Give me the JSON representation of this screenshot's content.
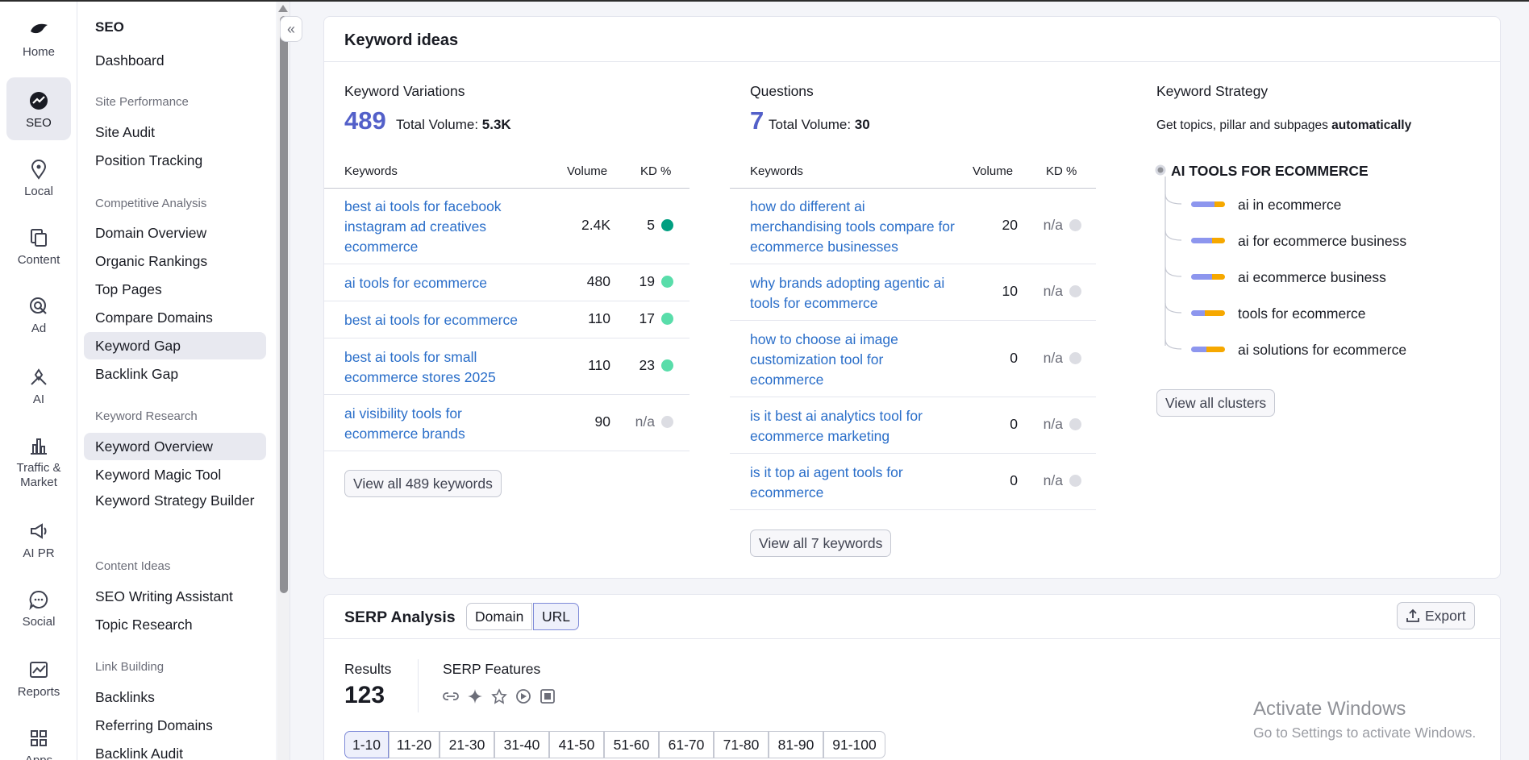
{
  "rail": [
    {
      "label": "Home",
      "icon": "home-icon"
    },
    {
      "label": "SEO",
      "icon": "seo-icon",
      "active": true
    },
    {
      "label": "Local",
      "icon": "location-pin-icon"
    },
    {
      "label": "Content",
      "icon": "content-icon"
    },
    {
      "label": "Ad",
      "icon": "ad-target-icon"
    },
    {
      "label": "AI",
      "icon": "ai-icon"
    },
    {
      "label": "Traffic &\nMarket",
      "icon": "bar-chart-icon"
    },
    {
      "label": "AI PR",
      "icon": "megaphone-icon"
    },
    {
      "label": "Social",
      "icon": "chat-bubble-icon"
    },
    {
      "label": "Reports",
      "icon": "reports-icon"
    },
    {
      "label": "Apps",
      "icon": "apps-grid-icon"
    }
  ],
  "sidebar": {
    "title": "SEO",
    "dashboard": "Dashboard",
    "groups": {
      "site_performance": "Site Performance",
      "competitive_analysis": "Competitive Analysis",
      "keyword_research": "Keyword Research",
      "content_ideas": "Content Ideas",
      "link_building": "Link Building"
    },
    "items": {
      "site_audit": "Site Audit",
      "position_tracking": "Position Tracking",
      "domain_overview": "Domain Overview",
      "organic_rankings": "Organic Rankings",
      "top_pages": "Top Pages",
      "compare_domains": "Compare Domains",
      "keyword_gap": "Keyword Gap",
      "backlink_gap": "Backlink Gap",
      "keyword_overview": "Keyword Overview",
      "keyword_magic_tool": "Keyword Magic Tool",
      "keyword_strategy_builder": "Keyword Strategy Builder",
      "seo_writing_assistant": "SEO Writing Assistant",
      "topic_research": "Topic Research",
      "backlinks": "Backlinks",
      "referring_domains": "Referring Domains",
      "backlink_audit": "Backlink Audit"
    },
    "collapse_glyph": "«"
  },
  "keyword_ideas": {
    "title": "Keyword ideas",
    "variations": {
      "title": "Keyword Variations",
      "count": "489",
      "total_label": "Total Volume:",
      "total_value": "5.3K",
      "headers": {
        "keyword": "Keywords",
        "volume": "Volume",
        "kd": "KD %"
      },
      "rows": [
        {
          "kw": "best ai tools for facebook instagram ad creatives ecommerce",
          "vol": "2.4K",
          "kd": "5",
          "color": "#009f81"
        },
        {
          "kw": "ai tools for ecommerce",
          "vol": "480",
          "kd": "19",
          "color": "#59ddaa"
        },
        {
          "kw": "best ai tools for ecommerce",
          "vol": "110",
          "kd": "17",
          "color": "#59ddaa"
        },
        {
          "kw": "best ai tools for small ecommerce stores 2025",
          "vol": "110",
          "kd": "23",
          "color": "#59ddaa"
        },
        {
          "kw": "ai visibility tools for ecommerce brands",
          "vol": "90",
          "kd": "n/a",
          "color": "#dcdde3"
        }
      ],
      "button": "View all 489 keywords"
    },
    "questions": {
      "title": "Questions",
      "count": "7",
      "total_label": "Total Volume:",
      "total_value": "30",
      "headers": {
        "keyword": "Keywords",
        "volume": "Volume",
        "kd": "KD %"
      },
      "rows": [
        {
          "kw": "how do different ai merchandising tools compare for ecommerce businesses",
          "vol": "20",
          "kd": "n/a",
          "color": "#dcdde3"
        },
        {
          "kw": "why brands adopting agentic ai tools for ecommerce",
          "vol": "10",
          "kd": "n/a",
          "color": "#dcdde3"
        },
        {
          "kw": "how to choose ai image customization tool for ecommerce",
          "vol": "0",
          "kd": "n/a",
          "color": "#dcdde3"
        },
        {
          "kw": "is it best ai analytics tool for ecommerce marketing",
          "vol": "0",
          "kd": "n/a",
          "color": "#dcdde3"
        },
        {
          "kw": "is it top ai agent tools for ecommerce",
          "vol": "0",
          "kd": "n/a",
          "color": "#dcdde3"
        }
      ],
      "button": "View all 7 keywords"
    },
    "strategy": {
      "title": "Keyword Strategy",
      "subtitle_pre": "Get topics, pillar and subpages",
      "subtitle_bold": "automatically",
      "root": "AI TOOLS FOR ECOMMERCE",
      "clusters": [
        {
          "label": "ai in ecommerce",
          "share": 0.68
        },
        {
          "label": "ai for ecommerce business",
          "share": 0.62
        },
        {
          "label": "ai ecommerce business",
          "share": 0.62
        },
        {
          "label": "tools for ecommerce",
          "share": 0.4
        },
        {
          "label": "ai solutions for ecommerce",
          "share": 0.45
        }
      ],
      "button": "View all clusters"
    }
  },
  "serp": {
    "title": "SERP Analysis",
    "toggle_domain": "Domain",
    "toggle_url": "URL",
    "export": "Export",
    "results_label": "Results",
    "results_value": "123",
    "features_label": "SERP Features",
    "feature_icons": [
      "link-icon",
      "sparkle-icon",
      "star-icon",
      "play-icon",
      "film-icon"
    ],
    "pages": [
      "1-10",
      "11-20",
      "21-30",
      "31-40",
      "41-50",
      "51-60",
      "61-70",
      "71-80",
      "81-90",
      "91-100"
    ],
    "active_page": "1-10"
  },
  "watermark": {
    "line1": "Activate Windows",
    "line2": "Go to Settings to activate Windows."
  },
  "colors": {
    "accent": "#5360c9",
    "link": "#2a6ec9",
    "kd_easy": "#009f81",
    "kd_medium": "#59ddaa",
    "kd_na": "#dcdde3",
    "bar_primary": "#8d96ee",
    "bar_secondary": "#f6a800"
  }
}
